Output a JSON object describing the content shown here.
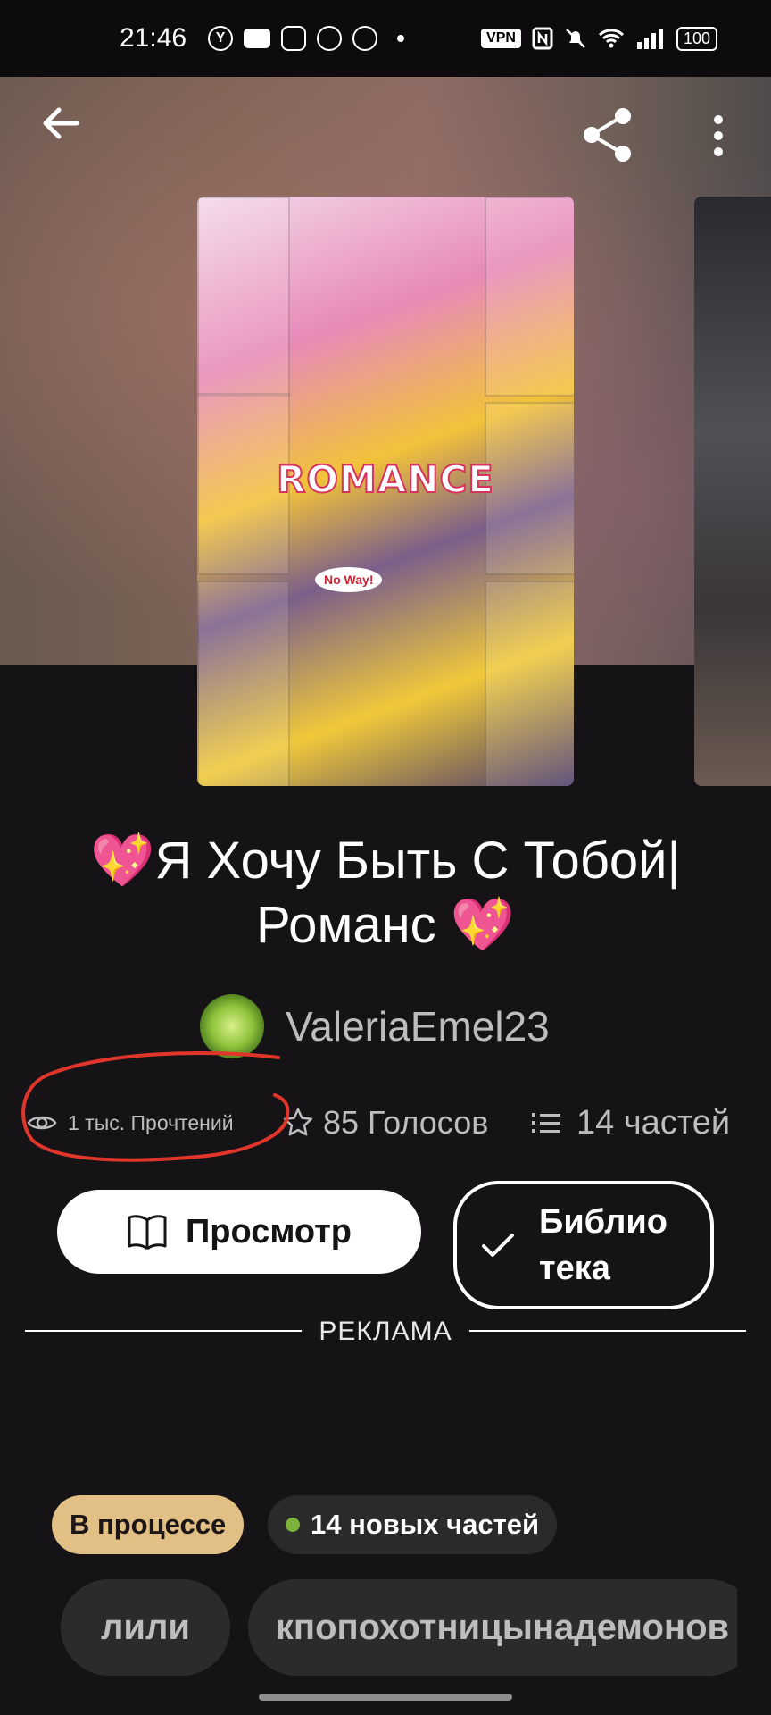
{
  "status_bar": {
    "time": "21:46",
    "vpn": "VPN",
    "battery": "100"
  },
  "story": {
    "title": "💖Я Хочу Быть С Тобой| Романс 💖",
    "cover_text": "ROMANCE",
    "cover_bubble": "No Way!",
    "author": "ValeriaEmel23"
  },
  "stats": {
    "reads": "1 тыс. Прочтений",
    "votes": "85 Голосов",
    "parts": "14 частей"
  },
  "actions": {
    "read_label": "Просмотр",
    "library_label": "Библио тека"
  },
  "ad_label": "РЕКЛАМА",
  "status_chips": {
    "status": "В процессе",
    "new_parts": "14 новых частей"
  },
  "tags": [
    "лили",
    "кпопохотницынадемонов"
  ],
  "colors": {
    "background": "#161316",
    "status_chip": "#e2bf84",
    "new_dot": "#7ab23c",
    "annotation": "#e0352b"
  },
  "icons": [
    "back-arrow-icon",
    "share-icon",
    "more-vert-icon",
    "eye-icon",
    "star-icon",
    "list-icon",
    "book-icon",
    "check-icon"
  ]
}
